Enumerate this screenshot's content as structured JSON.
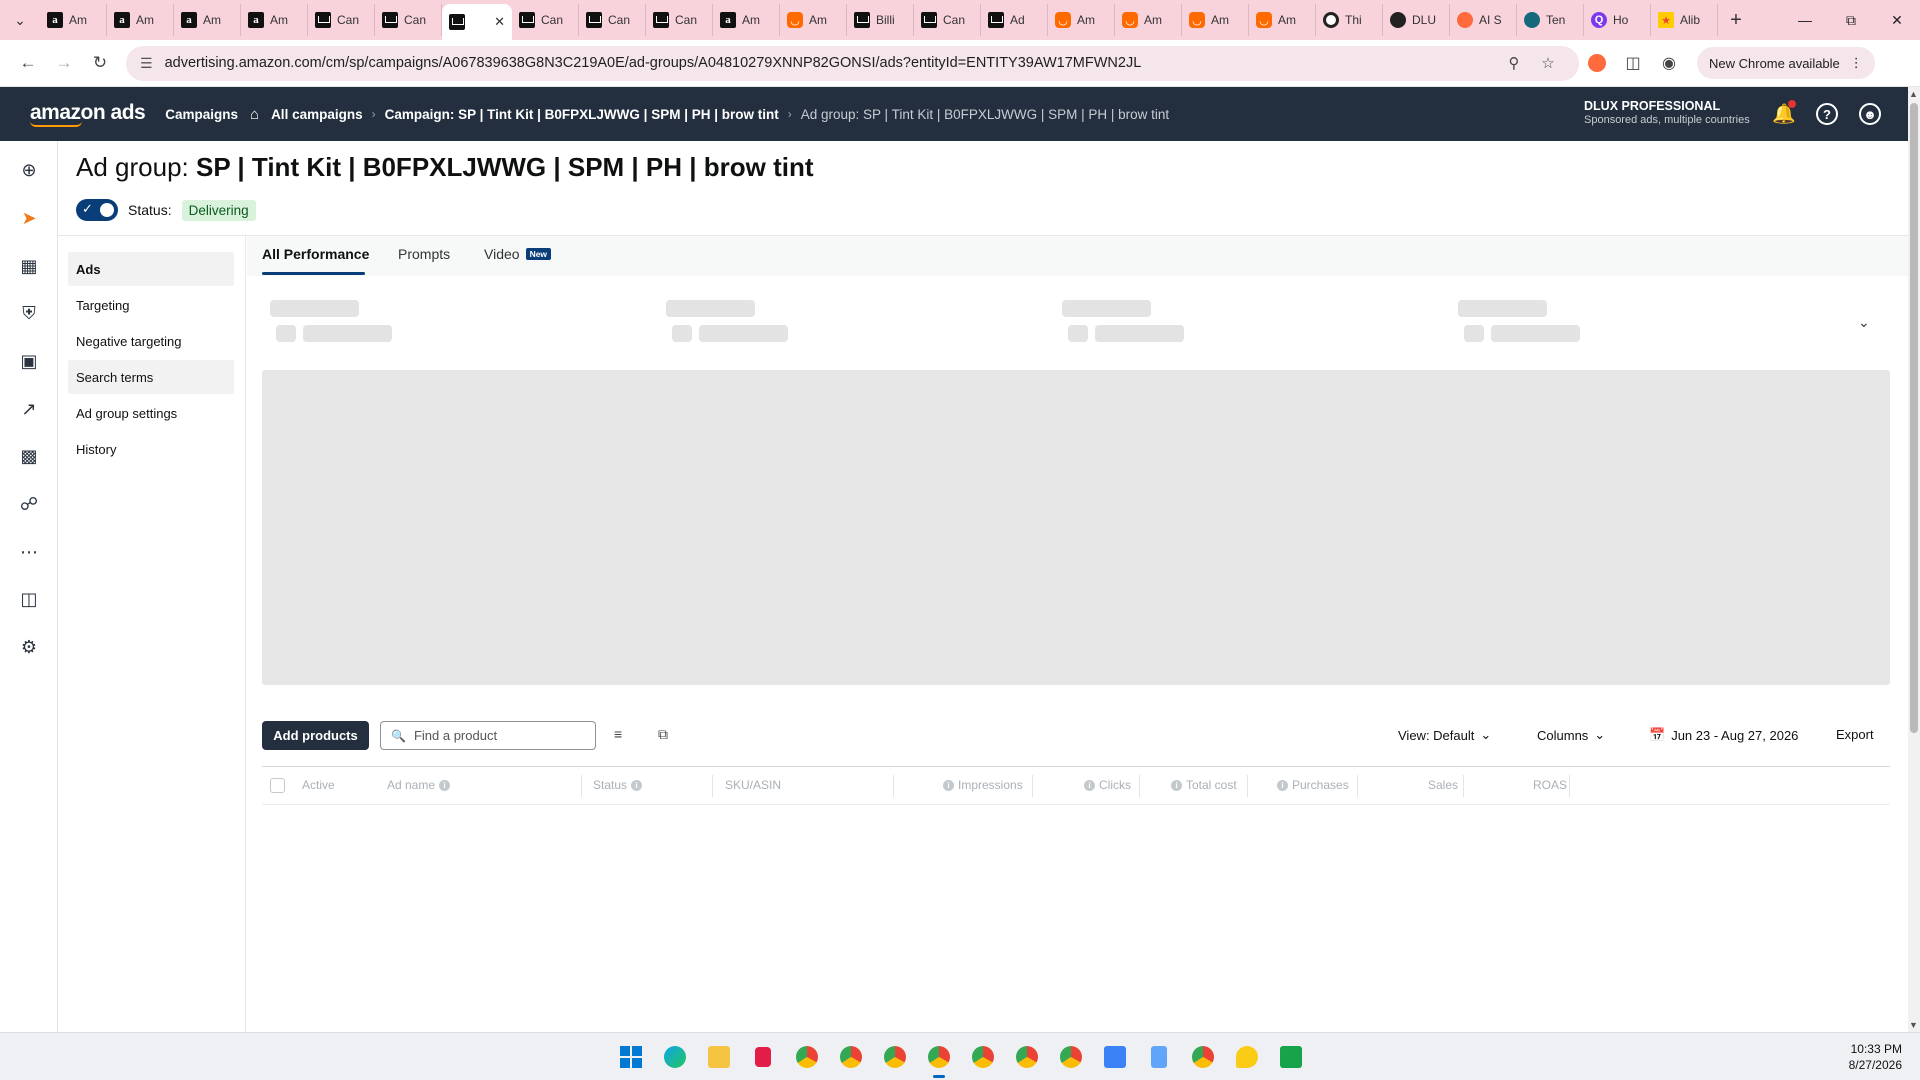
{
  "browser": {
    "tabs": [
      {
        "favicon": "amazon-icon",
        "label": "Am"
      },
      {
        "favicon": "amazon-icon",
        "label": "Am"
      },
      {
        "favicon": "amazon-icon",
        "label": "Am"
      },
      {
        "favicon": "amazon-icon",
        "label": "Am"
      },
      {
        "favicon": "mail-icon",
        "label": "Can"
      },
      {
        "favicon": "mail-icon",
        "label": "Can"
      },
      {
        "favicon": "mail-icon",
        "label": "",
        "active": true
      },
      {
        "favicon": "mail-icon",
        "label": "Can"
      },
      {
        "favicon": "mail-icon",
        "label": "Can"
      },
      {
        "favicon": "mail-icon",
        "label": "Can"
      },
      {
        "favicon": "amazon-icon",
        "label": "Am"
      },
      {
        "favicon": "orange-store-icon",
        "label": "Am"
      },
      {
        "favicon": "mail-icon",
        "label": "Billi"
      },
      {
        "favicon": "mail-icon",
        "label": "Can"
      },
      {
        "favicon": "mail-icon",
        "label": "Ad"
      },
      {
        "favicon": "orange-store-icon",
        "label": "Am"
      },
      {
        "favicon": "orange-store-icon",
        "label": "Am"
      },
      {
        "favicon": "orange-store-icon",
        "label": "Am"
      },
      {
        "favicon": "orange-store-icon",
        "label": "Am"
      },
      {
        "favicon": "white-circle-icon",
        "label": "Thi"
      },
      {
        "favicon": "dark-circle-icon",
        "label": "DLU"
      },
      {
        "favicon": "orange-circle-icon",
        "label": "AI S"
      },
      {
        "favicon": "teal-circle-icon",
        "label": "Ten"
      },
      {
        "favicon": "purple-q-icon",
        "label": "Ho"
      },
      {
        "favicon": "ali-icon",
        "label": "Alib"
      }
    ],
    "url": "advertising.amazon.com/cm/sp/campaigns/A067839638G8N3C219A0E/ad-groups/A04810279XNNP82GONSI/ads?entityId=ENTITY39AW17MFWN2JL",
    "chrome_available": "New Chrome available"
  },
  "header": {
    "logo": "amazon ads",
    "campaigns": "Campaigns",
    "breadcrumb": {
      "all_campaigns": "All campaigns",
      "campaign": "Campaign: SP | Tint Kit | B0FPXLJWWG | SPM | PH | brow tint",
      "ad_group": "Ad group: SP | Tint Kit | B0FPXLJWWG | SPM | PH | brow tint"
    },
    "account_name": "DLUX PROFESSIONAL",
    "account_sub": "Sponsored ads, multiple countries"
  },
  "page": {
    "title_prefix": "Ad group:",
    "title_name": "SP | Tint Kit | B0FPXLJWWG | SPM | PH | brow tint",
    "status_label": "Status:",
    "status_value": "Delivering"
  },
  "subnav": [
    "Ads",
    "Targeting",
    "Negative targeting",
    "Search terms",
    "Ad group settings",
    "History"
  ],
  "perf_tabs": {
    "all": "All Performance",
    "prompts": "Prompts",
    "video": "Video",
    "new_badge": "New"
  },
  "toolbar": {
    "add_products": "Add products",
    "search_placeholder": "Find a product",
    "view": "View: Default",
    "columns": "Columns",
    "date_range": "Jun 23 - Aug 27, 2026",
    "export": "Export"
  },
  "table": {
    "columns": [
      "Active",
      "Ad name",
      "Status",
      "SKU/ASIN",
      "Impressions",
      "Clicks",
      "Total cost",
      "Purchases",
      "Sales",
      "ROAS"
    ]
  },
  "taskbar": {
    "time": "10:33 PM",
    "date": "8/27/2026"
  },
  "colors": {
    "header_bg": "#232f3e",
    "accent": "#ff9900",
    "toggle": "#0a3e79",
    "status_badge_bg": "#d9f2dc"
  }
}
